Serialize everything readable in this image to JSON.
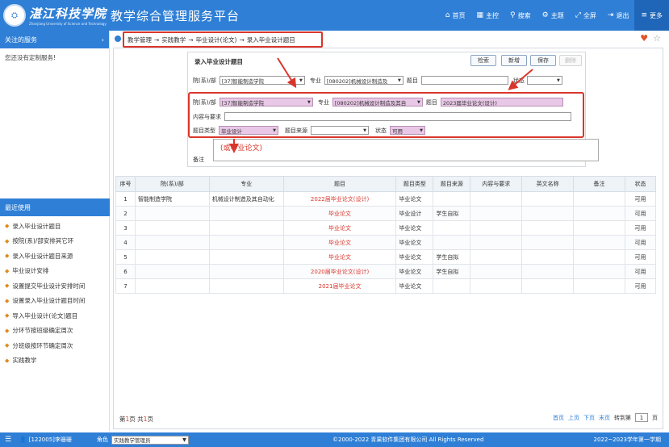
{
  "header": {
    "logo_text": "湛江科技学院",
    "logo_subtext": "Zhanjiang University of Science and Technology",
    "app_title": "教学综合管理服务平台",
    "nav": [
      {
        "icon": "home-icon",
        "glyph": "⌂",
        "label": "首页"
      },
      {
        "icon": "grid-icon",
        "glyph": "▦",
        "label": "主控"
      },
      {
        "icon": "search-icon",
        "glyph": "⚲",
        "label": "搜索"
      },
      {
        "icon": "theme-icon",
        "glyph": "⚙",
        "label": "主题"
      },
      {
        "icon": "fullscreen-icon",
        "glyph": "⤢",
        "label": "全屏"
      },
      {
        "icon": "logout-icon",
        "glyph": "⇥",
        "label": "退出"
      },
      {
        "icon": "menu-icon",
        "glyph": "≡",
        "label": "更多"
      }
    ]
  },
  "sidebar": {
    "followed_title": "关注的服务",
    "followed_empty": "您还没有定制服务!",
    "recent_title": "最近使用",
    "recent_items": [
      "录入毕业设计题目",
      "按院(系)/部安排其它环",
      "录入毕业设计题目来源",
      "毕业设计安排",
      "设置提交毕业设计安排时间",
      "设置录入毕业设计题目时间",
      "导入毕业设计(论文)题目",
      "分环节按班级确定周次",
      "分班级按环节确定周次",
      "实践教学"
    ]
  },
  "breadcrumb": {
    "items": [
      "教学管理",
      "实践教学",
      "毕业设计(论文)",
      "录入毕业设计题目"
    ]
  },
  "form": {
    "title": "录入毕业设计题目",
    "buttons": {
      "search": "检索",
      "add": "新增",
      "save": "保存",
      "delete": "删除"
    },
    "search_row": {
      "dept_label": "院(系)/部",
      "dept_value": "[37]智能制造学院",
      "major_label": "专业",
      "major_value": "[080202]机械设计制造及",
      "topic_label": "题目",
      "topic_value": "",
      "status_label": "状态",
      "status_value": ""
    },
    "edit_row": {
      "dept_label": "院(系)/部",
      "dept_value": "[37]智能制造学院",
      "major_label": "专业",
      "major_value": "[080202]机械设计制造及其自",
      "topic_label": "题目",
      "topic_value": "2023届毕业论文(设计)",
      "content_label": "内容与要求",
      "type_label": "题目类型",
      "type_value": "毕业设计",
      "source_label": "题目来源",
      "source_value": "",
      "status_label": "状态",
      "status_value": "可用",
      "remark_label": "备注",
      "hint": "(或毕业论文)"
    }
  },
  "table": {
    "headers": [
      "序号",
      "院(系)/部",
      "专业",
      "题目",
      "题目类型",
      "题目来源",
      "内容与要求",
      "英文名称",
      "备注",
      "状态"
    ],
    "rows": [
      {
        "no": "1",
        "dept": "智能制造学院",
        "major": "机械设计制造及其自动化",
        "topic": "2022届毕业论文(设计)",
        "type": "毕业论文",
        "source": "",
        "content": "",
        "en": "",
        "remark": "",
        "status": "可用"
      },
      {
        "no": "2",
        "dept": "",
        "major": "",
        "topic": "毕业论文",
        "type": "毕业设计",
        "source": "学生自拟",
        "content": "",
        "en": "",
        "remark": "",
        "status": "可用"
      },
      {
        "no": "3",
        "dept": "",
        "major": "",
        "topic": "毕业论文",
        "type": "毕业论文",
        "source": "",
        "content": "",
        "en": "",
        "remark": "",
        "status": "可用"
      },
      {
        "no": "4",
        "dept": "",
        "major": "",
        "topic": "毕业论文",
        "type": "毕业论文",
        "source": "",
        "content": "",
        "en": "",
        "remark": "",
        "status": "可用"
      },
      {
        "no": "5",
        "dept": "",
        "major": "",
        "topic": "毕业论文",
        "type": "毕业论文",
        "source": "学生自拟",
        "content": "",
        "en": "",
        "remark": "",
        "status": "可用"
      },
      {
        "no": "6",
        "dept": "",
        "major": "",
        "topic": "2020届毕业论文(设计)",
        "type": "毕业论文",
        "source": "学生自拟",
        "content": "",
        "en": "",
        "remark": "",
        "status": "可用"
      },
      {
        "no": "7",
        "dept": "",
        "major": "",
        "topic": "2021届毕业论文",
        "type": "毕业论文",
        "source": "",
        "content": "",
        "en": "",
        "remark": "",
        "status": "可用"
      }
    ]
  },
  "pager": {
    "prefix": "第",
    "page": "1",
    "mid": "页 共",
    "total": "1",
    "suffix": "页",
    "first": "首页",
    "prev": "上页",
    "next": "下页",
    "last": "末页",
    "goto_label": "转到第",
    "goto_value": "1",
    "goto_suffix": "页"
  },
  "footer": {
    "user": "[122005]李珊珊",
    "role_label": "角色",
    "role_value": "实践教学管理员",
    "copyright": "©2000-2022 青果软件集团有限公司 All Rights Reserved",
    "term": "2022~2023学年第一学期"
  },
  "colors": {
    "primary": "#2f7fd6",
    "highlight": "#d9362b",
    "pink_field": "#e8c8e6"
  }
}
